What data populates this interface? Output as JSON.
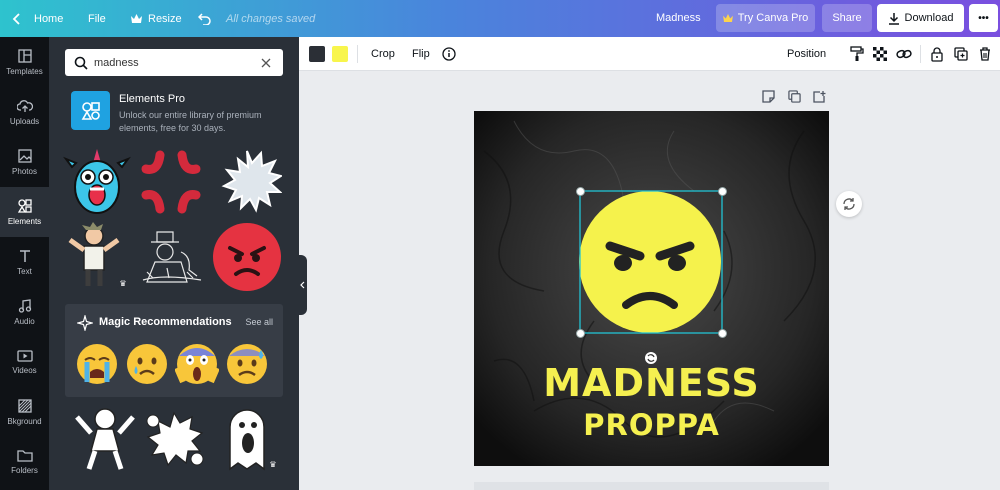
{
  "topbar": {
    "home_label": "Home",
    "file_label": "File",
    "resize_label": "Resize",
    "saved_status": "All changes saved",
    "design_name": "Madness",
    "try_pro_label": "Try Canva Pro",
    "share_label": "Share",
    "download_label": "Download",
    "more_label": "•••"
  },
  "sidebar": {
    "items": [
      {
        "label": "Templates",
        "icon": "templates-icon"
      },
      {
        "label": "Uploads",
        "icon": "uploads-icon"
      },
      {
        "label": "Photos",
        "icon": "photos-icon"
      },
      {
        "label": "Elements",
        "icon": "elements-icon"
      },
      {
        "label": "Text",
        "icon": "text-icon"
      },
      {
        "label": "Audio",
        "icon": "audio-icon"
      },
      {
        "label": "Videos",
        "icon": "videos-icon"
      },
      {
        "label": "Bkground",
        "icon": "background-icon"
      },
      {
        "label": "Folders",
        "icon": "folders-icon"
      }
    ],
    "active": "Elements"
  },
  "panel": {
    "search_value": "madness",
    "pro": {
      "title": "Elements Pro",
      "desc": "Unlock our entire library of premium elements, free for 30 days."
    },
    "magic": {
      "title": "Magic Recommendations",
      "see_all": "See all"
    }
  },
  "toolbar": {
    "swatch_colors": [
      "#2b2f36",
      "#f8f54c"
    ],
    "crop_label": "Crop",
    "flip_label": "Flip",
    "position_label": "Position"
  },
  "canvas": {
    "title": "MADNESS",
    "subtitle": "PROPPA",
    "text_color": "#f5f050",
    "emoji_color": "#f5f24c"
  }
}
